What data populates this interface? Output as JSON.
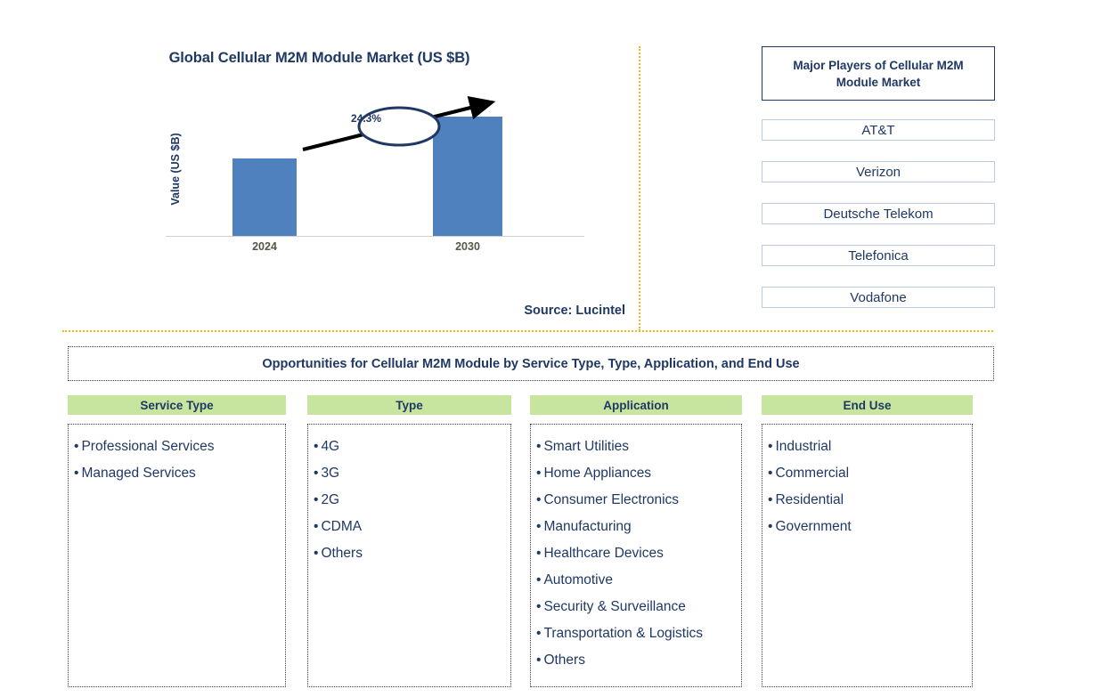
{
  "chart_data": {
    "type": "bar",
    "title": "Global Cellular M2M Module Market (US $B)",
    "categories": [
      "2024",
      "2030"
    ],
    "values": [
      100,
      155
    ],
    "xlabel": "",
    "ylabel": "Value (US $B)",
    "ylim": [
      0,
      180
    ],
    "grid": false,
    "legend": "none",
    "annotations": [
      {
        "label": "24.3%",
        "type": "cagr-callout",
        "description": "Upward arrow with oval label between 2024 and 2030 bars"
      }
    ],
    "series": [
      {
        "name": "Market Value",
        "values": [
          100,
          155
        ]
      }
    ],
    "bar_color": "#4E81BD",
    "source": "Source: Lucintel"
  },
  "chart": {
    "title": "Global Cellular M2M Module Market (US $B)",
    "y_axis_label": "Value (US $B)",
    "ticks": [
      "2024",
      "2030"
    ],
    "cagr_label": "24.3%",
    "source": "Source: Lucintel"
  },
  "players": {
    "header": "Major Players of Cellular M2M Module Market",
    "items": [
      "AT&T",
      "Verizon",
      "Deutsche Telekom",
      "Telefonica",
      "Vodafone"
    ]
  },
  "opportunities": {
    "header": "Opportunities for Cellular M2M Module by Service Type, Type, Application, and End Use",
    "bullet": "•",
    "columns": [
      {
        "title": "Service Type",
        "items": [
          "Professional Services",
          "Managed Services"
        ]
      },
      {
        "title": "Type",
        "items": [
          "4G",
          "3G",
          "2G",
          "CDMA",
          "Others"
        ]
      },
      {
        "title": "Application",
        "items": [
          "Smart Utilities",
          "Home Appliances",
          "Consumer Electronics",
          "Manufacturing",
          "Healthcare Devices",
          "Automotive",
          "Security & Surveillance",
          "Transportation & Logistics",
          "Others"
        ]
      },
      {
        "title": "End Use",
        "items": [
          "Industrial",
          "Commercial",
          "Residential",
          "Government"
        ]
      }
    ]
  },
  "colors": {
    "bar_blue": "#4E81BD",
    "navy_text": "#1F3864",
    "header_green": "#C8E5A0",
    "divider_orange": "#FFB515",
    "player_border": "#B8CCE4",
    "axis_tick_text": "#595548"
  }
}
